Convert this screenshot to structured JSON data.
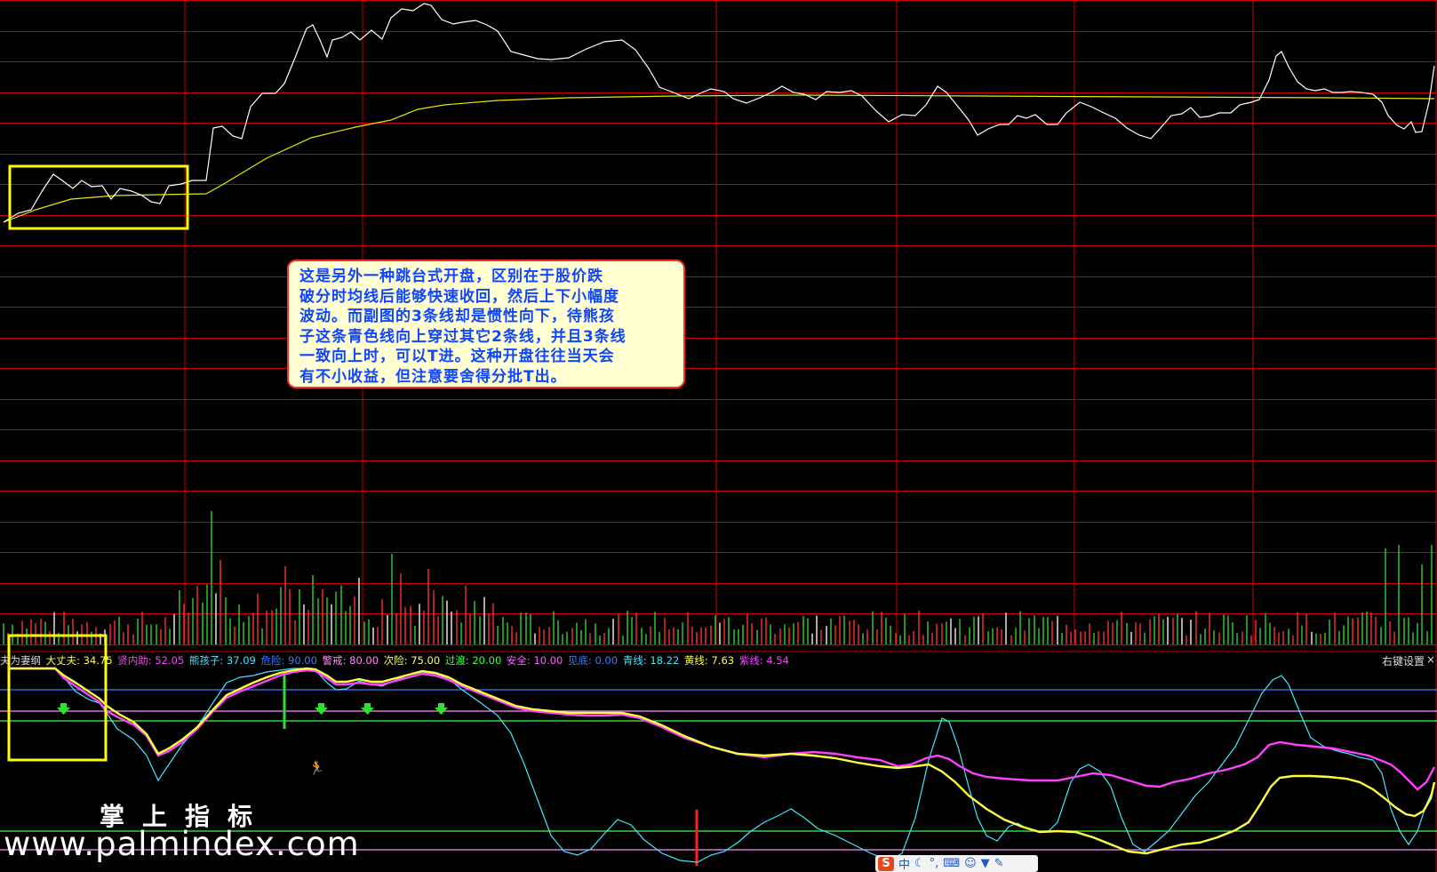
{
  "annotation": {
    "lines": [
      "这是另外一种跳台式开盘，区别在于股价跌",
      "破分时均线后能够快速收回，然后上下小幅度",
      "波动。而副图的3条线却是惯性向下，待熊孩",
      "子这条青色线向上穿过其它2条线，并且3条线",
      "一致向上时，可以T进。这种开盘往往当天会",
      "有不小收益，但注意要舍得分批T出。"
    ]
  },
  "indicator_legend": [
    {
      "label": "夫为妻纲",
      "value": "",
      "color": "#d8d8d8"
    },
    {
      "label": "大丈夫:",
      "value": "34.75",
      "color": "#ffff40"
    },
    {
      "label": "贤内助:",
      "value": "52.05",
      "color": "#ff40ff"
    },
    {
      "label": "熊孩子:",
      "value": "37.09",
      "color": "#40e8ff"
    },
    {
      "label": "危险:",
      "value": "90.00",
      "color": "#3a7cff"
    },
    {
      "label": "警戒:",
      "value": "80.00",
      "color": "#ff8aff"
    },
    {
      "label": "次险:",
      "value": "75.00",
      "color": "#ffff60"
    },
    {
      "label": "过渡:",
      "value": "20.00",
      "color": "#40ff40"
    },
    {
      "label": "安全:",
      "value": "10.00",
      "color": "#ff60ff"
    },
    {
      "label": "见底:",
      "value": "0.00",
      "color": "#3a7cff"
    },
    {
      "label": "青线:",
      "value": "18.22",
      "color": "#40e8ff"
    },
    {
      "label": "黄线:",
      "value": "7.63",
      "color": "#ffff40"
    },
    {
      "label": "紫线:",
      "value": "4.54",
      "color": "#ff40ff"
    }
  ],
  "right_key": {
    "label": "右键设置",
    "close": "×"
  },
  "watermark": {
    "title": "掌上指标",
    "url": "www.palmindex.com"
  },
  "ime_toolbar": {
    "logo": "S",
    "mode": "中",
    "icons": [
      "moon-icon",
      "punctuation-icon",
      "keyboard-icon",
      "user-icon",
      "shirt-icon",
      "wrench-icon"
    ]
  },
  "colors": {
    "grid_red": "#c80000",
    "price_line": "#ffffff",
    "avg_line": "#e8e800",
    "highlight_box": "#ffff00",
    "cyan_line": "#40e8ff",
    "yellow_line": "#ffff40",
    "magenta_line": "#ff40ff"
  }
}
